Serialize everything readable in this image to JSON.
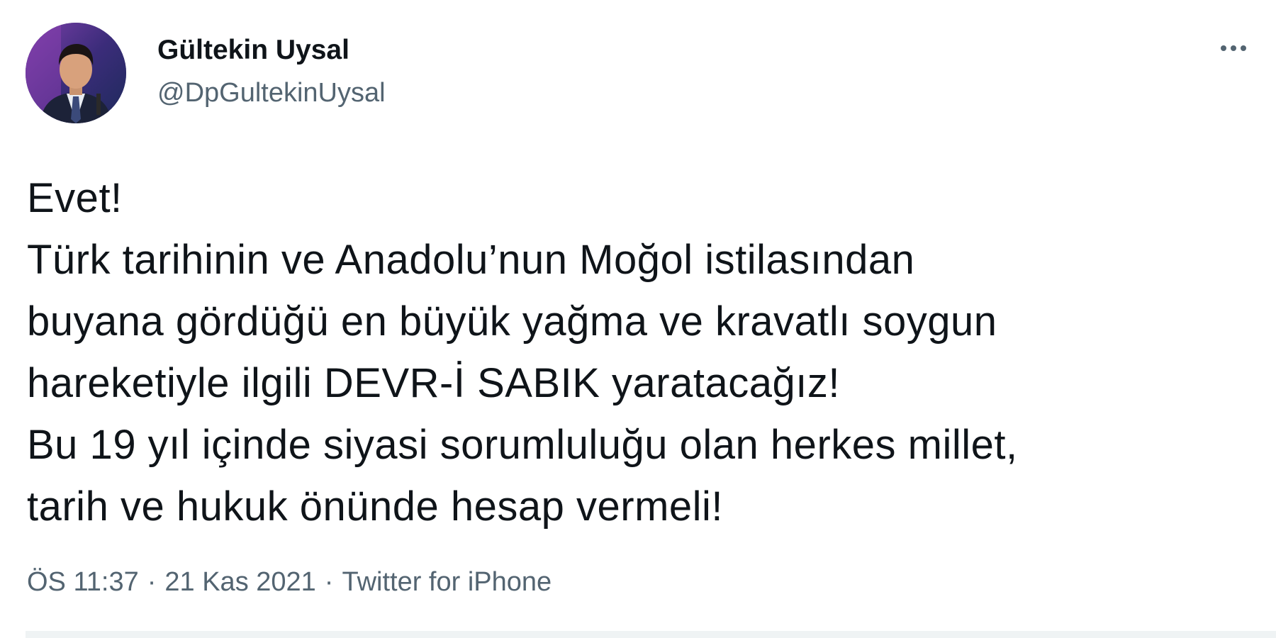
{
  "author": {
    "display_name": "Gültekin Uysal",
    "handle": "@DpGultekinUysal"
  },
  "tweet": {
    "lines": [
      "Evet!",
      "Türk tarihinin ve Anadolu’nun Moğol istilasından",
      "buyana gördüğü en büyük yağma ve kravatlı soygun",
      "hareketiyle ilgili DEVR-İ SABIK yaratacağız!",
      "Bu 19 yıl içinde siyasi sorumluluğu olan herkes millet,",
      "tarih ve hukuk önünde hesap vermeli!"
    ]
  },
  "meta": {
    "time": "ÖS 11:37",
    "date": "21 Kas 2021",
    "source": "Twitter for iPhone",
    "separator": "·"
  },
  "icons": {
    "more": "more-horizontal-icon"
  },
  "colors": {
    "text_primary": "#0f1419",
    "text_secondary": "#536471",
    "divider": "#eff3f4"
  }
}
